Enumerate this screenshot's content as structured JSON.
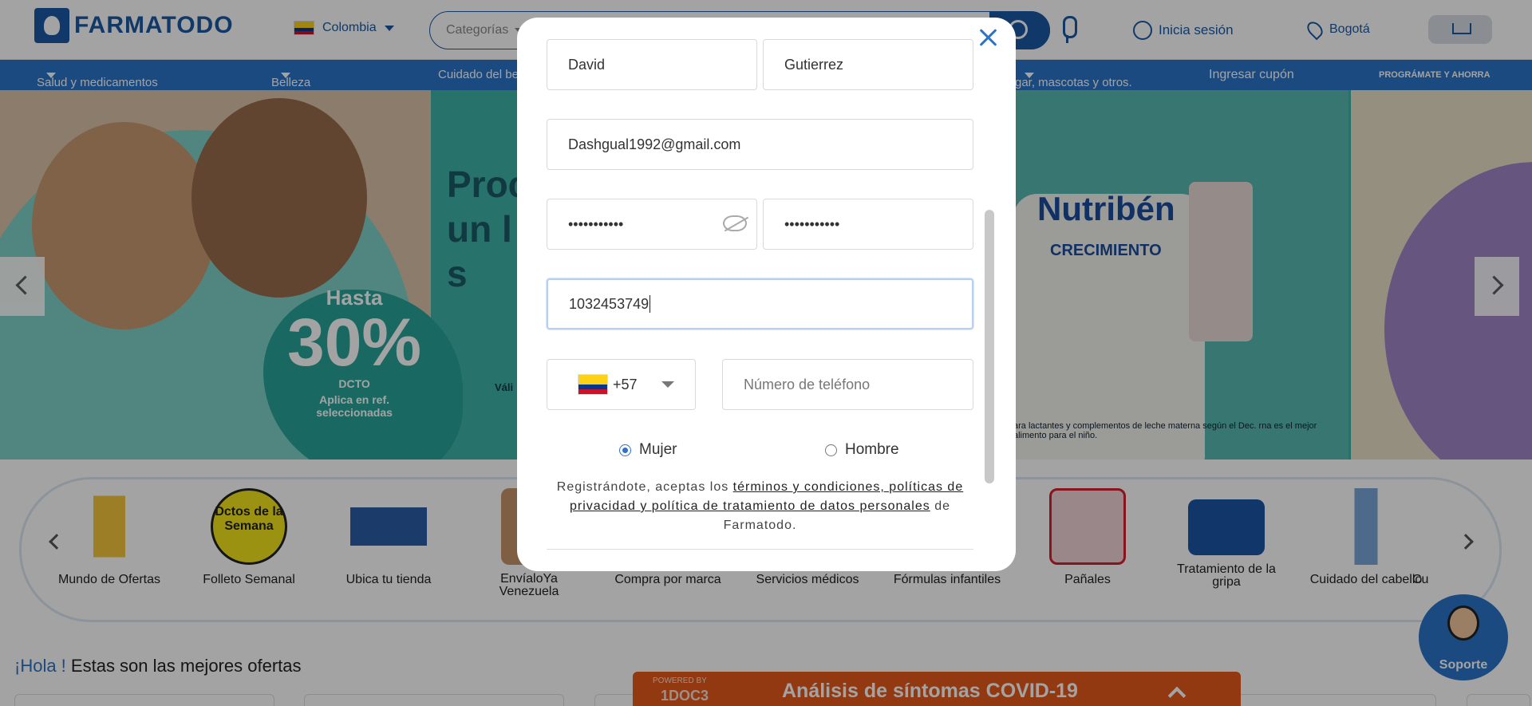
{
  "header": {
    "logo_text": "FARMATODO",
    "country": "Colombia",
    "search_category": "Categorías",
    "login": "Inicia sesión",
    "city": "Bogotá"
  },
  "nav": {
    "items": [
      "Salud y medicamentos",
      "Belleza",
      "Cuidado del be",
      "gar, mascotas y otros.",
      "Ingresar cupón",
      "PROGRÁMATE Y AHORRA"
    ]
  },
  "banner": {
    "headline_line1": "Proc",
    "headline_line2": "un l",
    "headline_line3": "s",
    "hasta": "Hasta",
    "discount": "30%",
    "dcto": "DCTO",
    "note_line1": "Aplica en ref.",
    "note_line2": "seleccionadas",
    "valid": "Váli",
    "product_brand": "Nutribén",
    "product_line": "CRECIMIENTO",
    "fine_print": "ara lactantes y complementos de leche materna según el Dec. rna es el mejor alimento para el niño."
  },
  "categories": [
    "Mundo de Ofertas",
    "Folleto Semanal",
    "Ubica tu tienda",
    "EnvíaloYa Venezuela",
    "Compra por marca",
    "Servicios médicos",
    "Fórmulas infantiles",
    "Pañales",
    "Tratamiento de la gripa",
    "Cuidado del cabello",
    "Cu"
  ],
  "folleto_badge": "Dctos de la Semana",
  "offers": {
    "hola": "¡Hola !",
    "text": "Estas son las mejores ofertas"
  },
  "covid": {
    "powered": "POWERED BY",
    "brand": "1DOC3",
    "title": "Análisis de síntomas COVID-19"
  },
  "support": "Soporte",
  "form": {
    "first_name": "David",
    "last_name": "Gutierrez",
    "email": "Dashgual1992@gmail.com",
    "password": "•••••••••••",
    "password_confirm": "•••••••••••",
    "document": "1032453749",
    "country_code": "+57",
    "phone_placeholder": "Número de teléfono",
    "gender_female": "Mujer",
    "gender_male": "Hombre",
    "gender_selected": "Mujer",
    "terms_prefix": "Registrándote, aceptas los ",
    "terms_link": "términos y condiciones, políticas de privacidad y política de tratamiento de datos personales",
    "terms_suffix": " de Farmatodo."
  },
  "colors": {
    "brand_blue": "#1a5aa6",
    "nav_blue": "#2b74c8",
    "covid_orange": "#e55a1c"
  }
}
